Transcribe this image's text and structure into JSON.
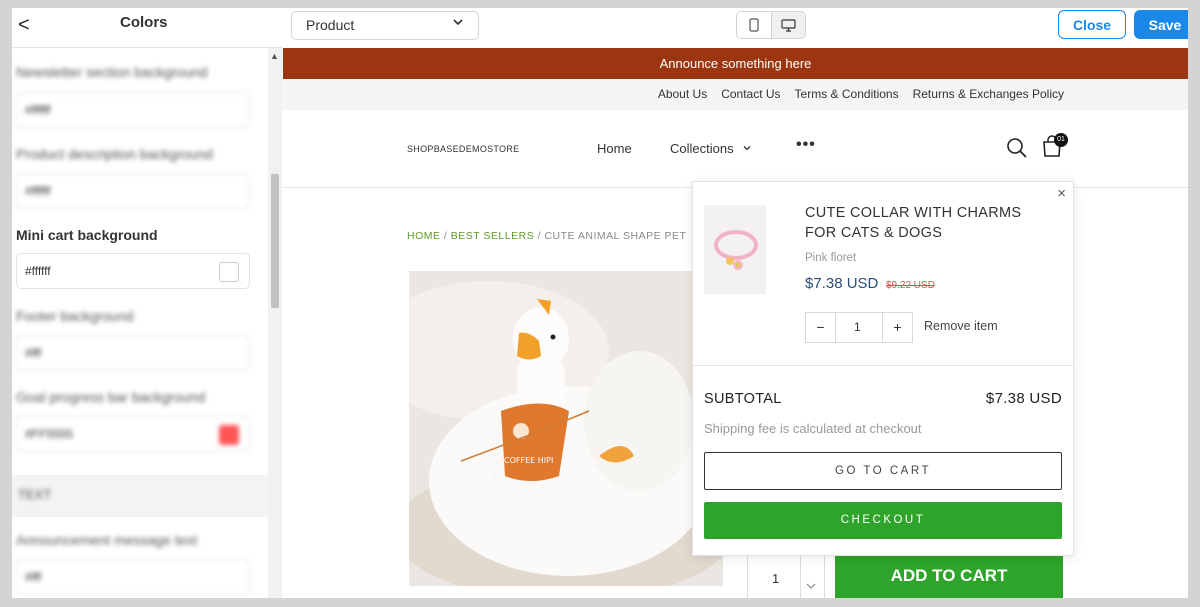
{
  "editor": {
    "back_glyph": "<",
    "panel_title": "Colors",
    "page_selector": "Product",
    "close_label": "Close",
    "save_label": "Save"
  },
  "sidebar": {
    "blurred_label_1": "Newsletter section background",
    "blurred_value_1": "#ffffff",
    "blurred_label_2": "Product description background",
    "blurred_value_2": "#ffffff",
    "field_label": "Mini cart background",
    "field_value": "#ffffff",
    "blurred_label_3": "Footer background",
    "blurred_value_3": "#fff",
    "blurred_label_4": "Goal progress bar background",
    "blurred_value_4": "#FF5555",
    "section_label": "TEXT",
    "blurred_label_5": "Announcement message text",
    "blurred_value_5": "#fff"
  },
  "store": {
    "announcement": "Announce something here",
    "top_links": [
      "About Us",
      "Contact Us",
      "Terms & Conditions",
      "Returns & Exchanges Policy"
    ],
    "logo": "SHOPBASEDEMOSTORE",
    "nav_home": "Home",
    "nav_collections": "Collections",
    "nav_more": "•••",
    "cart_count": "01",
    "breadcrumb_home": "HOME",
    "breadcrumb_sep1": " / ",
    "breadcrumb_cat": "BEST SELLERS",
    "breadcrumb_sep2": " / ",
    "breadcrumb_current": "CUTE ANIMAL SHAPE PET",
    "apron_text": "COFFEE HIPI",
    "qty": "1",
    "add_to_cart": "ADD TO CART"
  },
  "minicart": {
    "close_glyph": "×",
    "product_name": "CUTE COLLAR WITH CHARMS FOR CATS & DOGS",
    "variant": "Pink floret",
    "price": "$7.38 USD",
    "old_price": "$9.22 USD",
    "qty": "1",
    "minus": "−",
    "plus": "+",
    "remove": "Remove item",
    "subtotal_label": "SUBTOTAL",
    "subtotal_value": "$7.38 USD",
    "shipping_note": "Shipping fee is calculated at checkout",
    "go_to_cart": "GO TO CART",
    "checkout": "CHECKOUT"
  },
  "colors": {
    "announcement_bg": "#9b3610",
    "accent_green": "#2ea52a",
    "primary_blue": "#1a88e8",
    "price_blue": "#2a4d7a",
    "old_price_red": "#d9534f"
  },
  "icons": [
    "back-arrow-icon",
    "chevron-down-icon",
    "mobile-icon",
    "desktop-icon",
    "search-icon",
    "cart-icon",
    "close-icon",
    "scroll-up-icon"
  ]
}
